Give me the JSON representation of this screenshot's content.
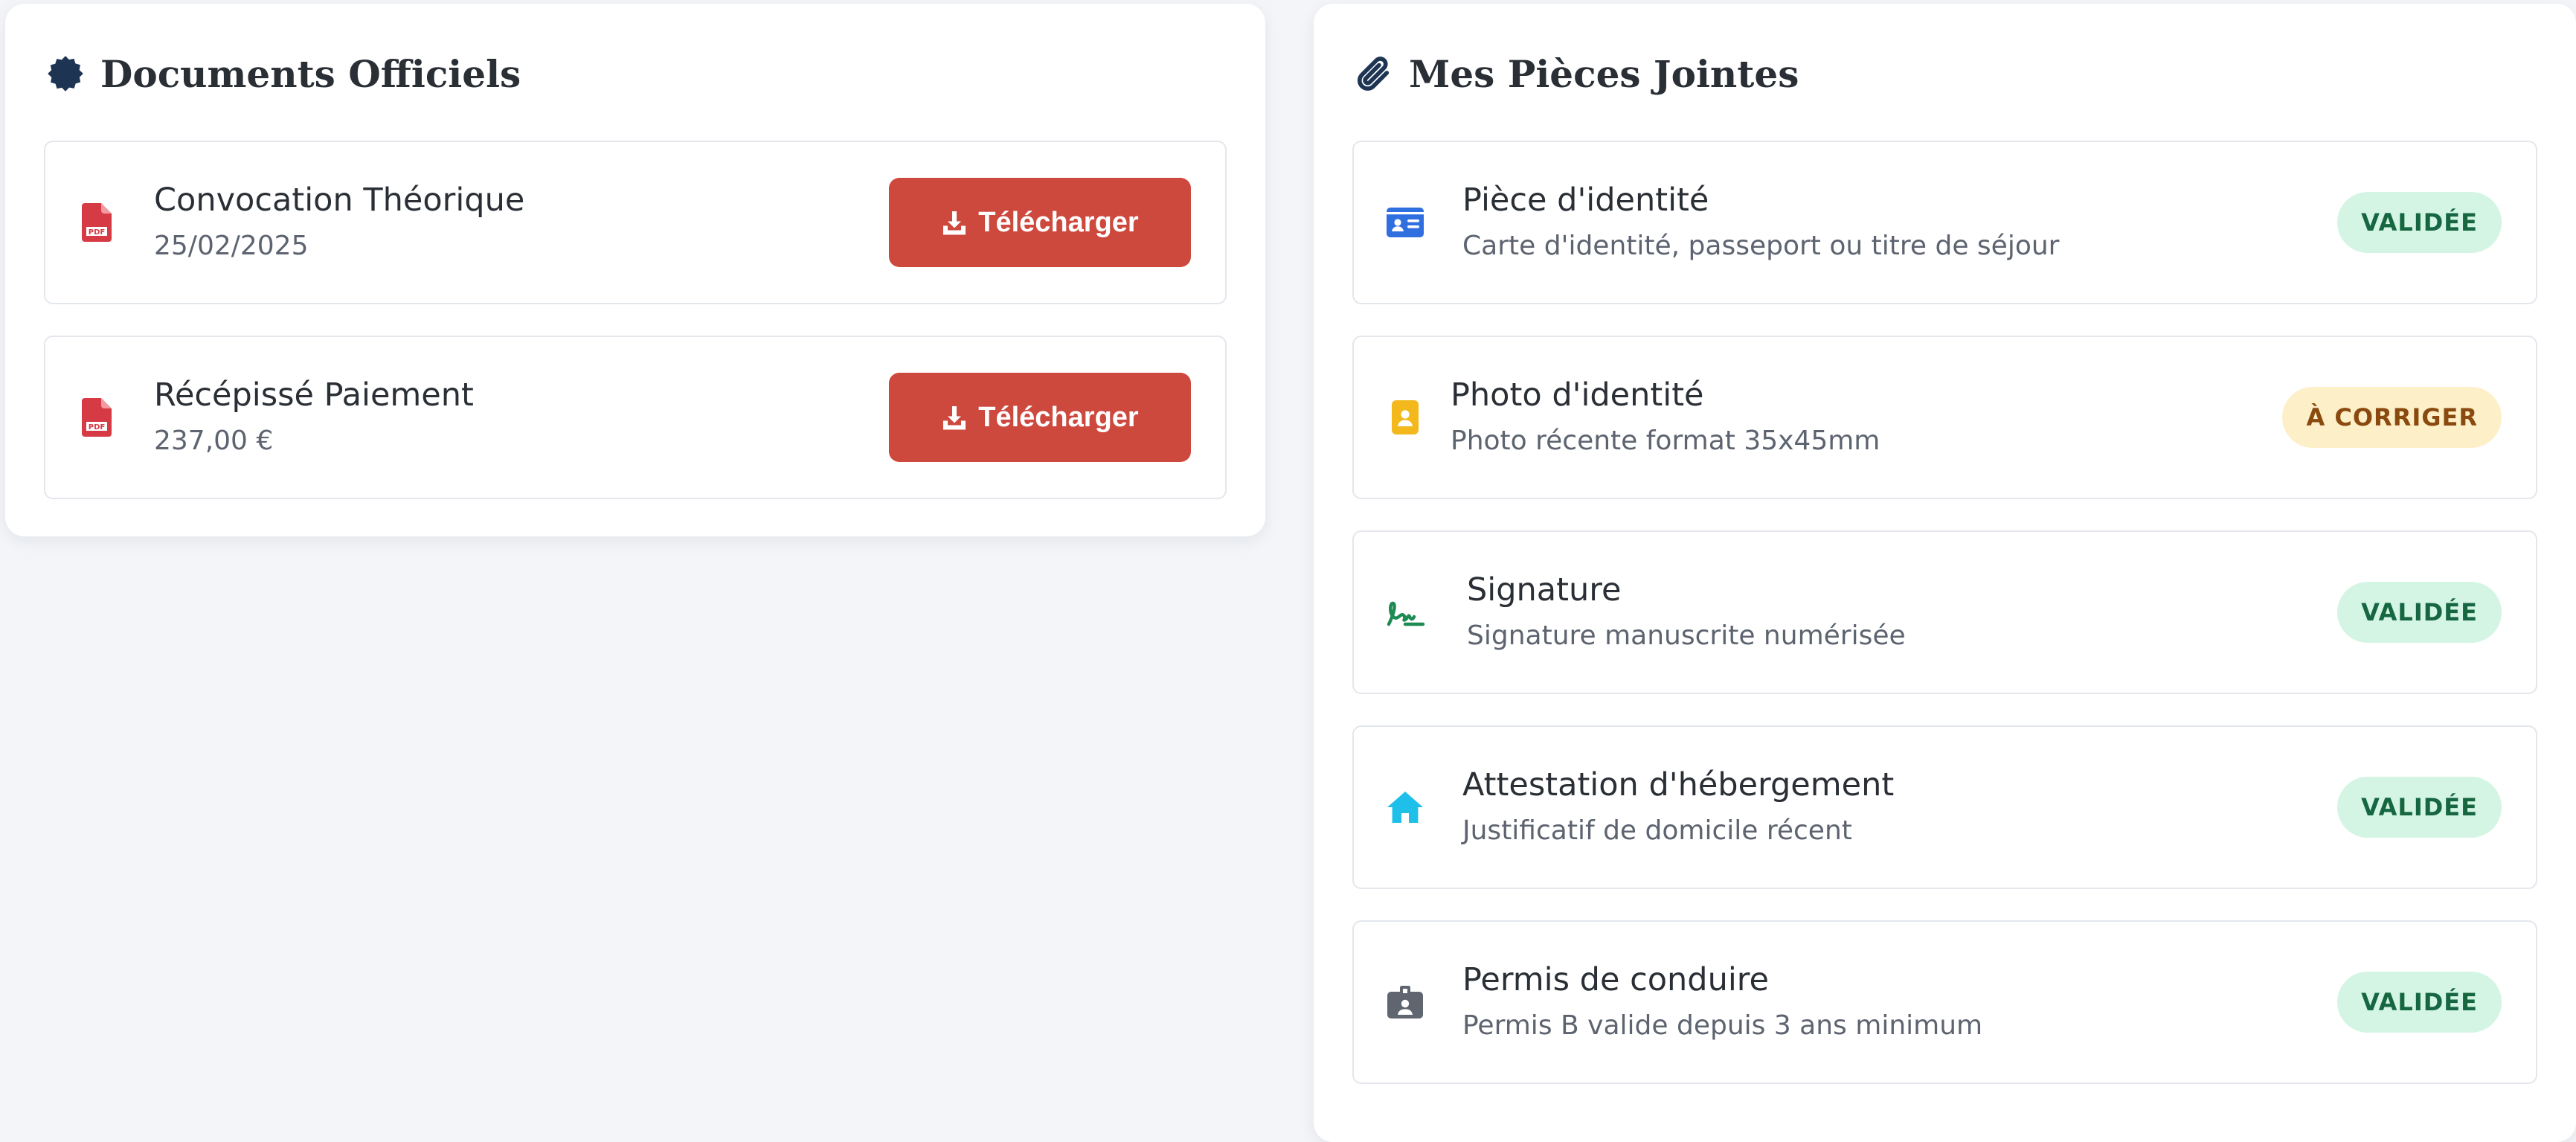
{
  "official": {
    "title": "Documents Officiels",
    "icon": "certificate-icon",
    "items": [
      {
        "name": "Convocation Théorique",
        "detail": "25/02/2025",
        "icon": "pdf-file-icon",
        "button": "Télécharger"
      },
      {
        "name": "Récépissé Paiement",
        "detail": "237,00 €",
        "icon": "pdf-file-icon",
        "button": "Télécharger"
      }
    ]
  },
  "attachments": {
    "title": "Mes Pièces Jointes",
    "icon": "paperclip-icon",
    "items": [
      {
        "name": "Pièce d'identité",
        "detail": "Carte d'identité, passeport ou titre de séjour",
        "icon": "id-card-icon",
        "status": "VALIDÉE"
      },
      {
        "name": "Photo d'identité",
        "detail": "Photo récente format 35x45mm",
        "icon": "portrait-icon",
        "status": "À CORRIGER"
      },
      {
        "name": "Signature",
        "detail": "Signature manuscrite numérisée",
        "icon": "signature-icon",
        "status": "VALIDÉE"
      },
      {
        "name": "Attestation d'hébergement",
        "detail": "Justificatif de domicile récent",
        "icon": "house-icon",
        "status": "VALIDÉE"
      },
      {
        "name": "Permis de conduire",
        "detail": "Permis B valide depuis 3 ans minimum",
        "icon": "id-badge-icon",
        "status": "VALIDÉE"
      }
    ]
  },
  "colors": {
    "download_button": "#cd483d",
    "badge_valid_bg": "#d4f5e4",
    "badge_valid_text": "#166741",
    "badge_fix_bg": "#fdf0c8",
    "badge_fix_text": "#8a4a0f",
    "pdf_icon": "#d63a44",
    "id_card_icon": "#2f6fe0",
    "portrait_icon": "#f2b81c",
    "signature_icon": "#1d8a53",
    "house_icon": "#1ec0ea",
    "id_badge_icon": "#5f6670"
  }
}
